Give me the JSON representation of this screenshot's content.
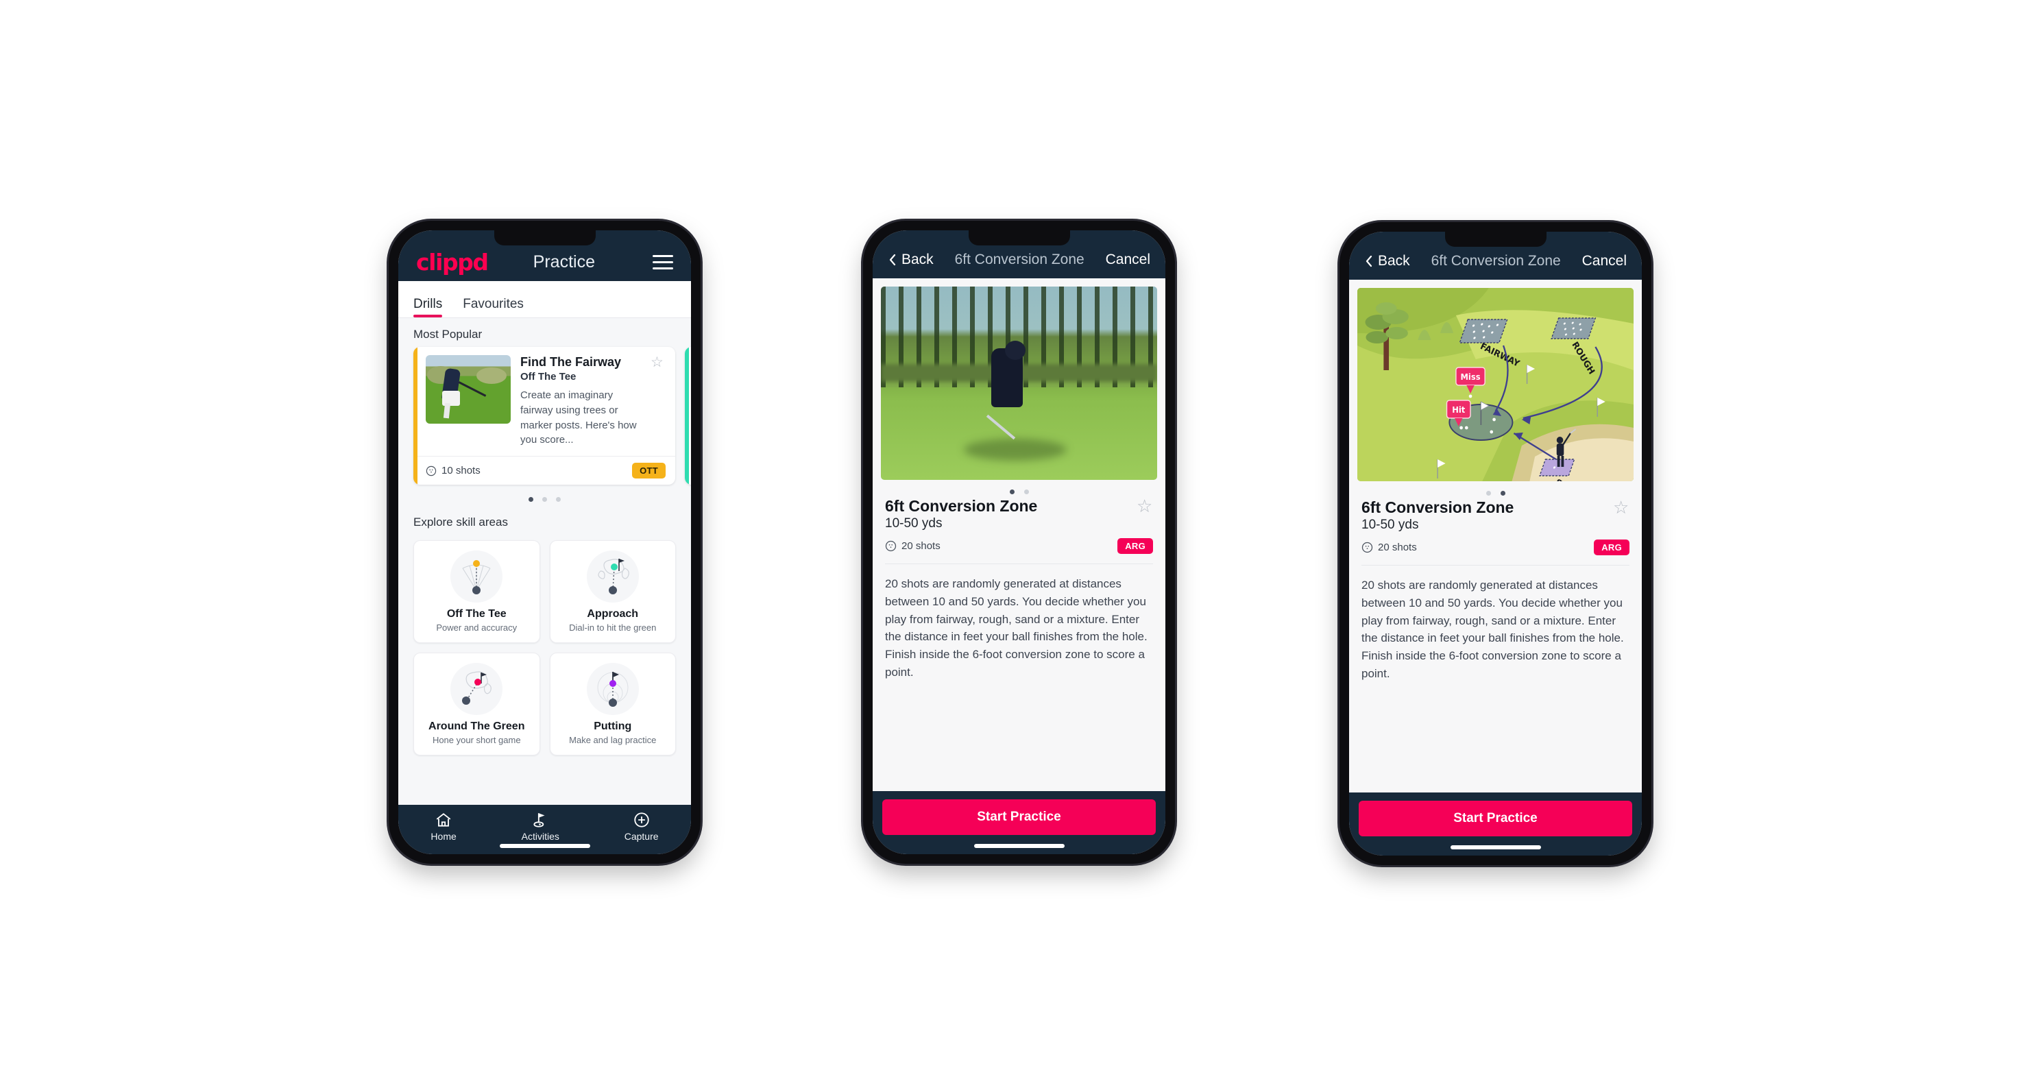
{
  "app": {
    "logo_text": "clippd",
    "brand_pink": "#f50057",
    "brand_dark": "#17293a",
    "accent_amber": "#f5b21a",
    "accent_teal": "#2fdcb0"
  },
  "phone1": {
    "header": {
      "title": "Practice",
      "menu_icon": "hamburger-icon"
    },
    "tabs": [
      {
        "label": "Drills",
        "active": true
      },
      {
        "label": "Favourites",
        "active": false
      }
    ],
    "most_popular": {
      "section_label": "Most Popular",
      "card": {
        "title": "Find The Fairway",
        "subtitle": "Off The Tee",
        "description": "Create an imaginary fairway using trees or marker posts. Here's how you score...",
        "shots": "10 shots",
        "badge": "OTT",
        "favourite_icon": "star-outline-icon",
        "accent_color": "#f5b21a"
      },
      "pager": {
        "count": 3,
        "active_index": 0
      }
    },
    "explore": {
      "section_label": "Explore skill areas",
      "skills": [
        {
          "name": "Off The Tee",
          "desc": "Power and accuracy",
          "icon": "tee-fan-icon",
          "dot_color": "#f5b21a"
        },
        {
          "name": "Approach",
          "desc": "Dial-in to hit the green",
          "icon": "approach-green-icon",
          "dot_color": "#2fdcb0"
        },
        {
          "name": "Around The Green",
          "desc": "Hone your short game",
          "icon": "chip-green-icon",
          "dot_color": "#f50057"
        },
        {
          "name": "Putting",
          "desc": "Make and lag practice",
          "icon": "putting-rings-icon",
          "dot_color": "#a020f0"
        }
      ]
    },
    "bottom_nav": [
      {
        "label": "Home",
        "icon": "home-icon",
        "active": false
      },
      {
        "label": "Activities",
        "icon": "golf-flag-icon",
        "active": true
      },
      {
        "label": "Capture",
        "icon": "plus-circle-icon",
        "active": false
      }
    ]
  },
  "phone2": {
    "navbar": {
      "back": "Back",
      "title": "6ft Conversion Zone",
      "cancel": "Cancel",
      "back_icon": "chevron-left-icon"
    },
    "media": {
      "type": "photo",
      "alt": "golfer chipping on a tree-lined course"
    },
    "pager": {
      "count": 2,
      "active_index": 0
    },
    "detail": {
      "title": "6ft Conversion Zone",
      "subtitle": "10-50 yds",
      "shots": "20 shots",
      "badge": "ARG",
      "favourite_icon": "star-outline-icon",
      "description": "20 shots are randomly generated at distances between 10 and 50 yards. You decide whether you play from fairway, rough, sand or a mixture. Enter the distance in feet your ball finishes from the hole. Finish inside the 6-foot conversion zone to score a point."
    },
    "cta": "Start Practice"
  },
  "phone3": {
    "navbar": {
      "back": "Back",
      "title": "6ft Conversion Zone",
      "cancel": "Cancel",
      "back_icon": "chevron-left-icon"
    },
    "media": {
      "type": "illustration",
      "labels": {
        "fairway": "FAIRWAY",
        "rough": "ROUGH",
        "sand": "SAND",
        "miss": "Miss",
        "hit": "Hit"
      }
    },
    "pager": {
      "count": 2,
      "active_index": 1
    },
    "detail": {
      "title": "6ft Conversion Zone",
      "subtitle": "10-50 yds",
      "shots": "20 shots",
      "badge": "ARG",
      "favourite_icon": "star-outline-icon",
      "description": "20 shots are randomly generated at distances between 10 and 50 yards. You decide whether you play from fairway, rough, sand or a mixture. Enter the distance in feet your ball finishes from the hole. Finish inside the 6-foot conversion zone to score a point."
    },
    "cta": "Start Practice"
  }
}
